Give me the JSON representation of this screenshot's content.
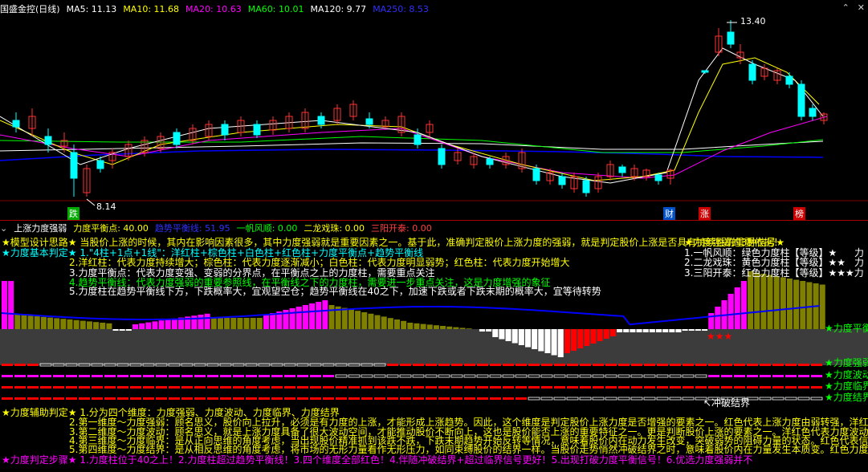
{
  "header": {
    "stock": "国盛金控(日线)",
    "ma": [
      {
        "label": "MA5: 11.13",
        "color": "#ffffff"
      },
      {
        "label": "MA10: 11.68",
        "color": "#ffff00"
      },
      {
        "label": "MA20: 10.63",
        "color": "#ff00ff"
      },
      {
        "label": "MA60: 10.01",
        "color": "#00ff00"
      },
      {
        "label": "MA120: 9.77",
        "color": "#ffffff"
      },
      {
        "label": "MA250: 8.53",
        "color": "#0000ff"
      }
    ]
  },
  "window": {
    "collapse_icon": "chevron-up-icon",
    "close_icon": "close-icon"
  },
  "price_annotations": {
    "high": "13.40",
    "low": "8.14"
  },
  "bottom_markers": [
    {
      "label": "跌",
      "color": "#00aa00"
    },
    {
      "label": "财",
      "color": "#0050c8"
    },
    {
      "label": "涨",
      "color": "#cc0000"
    },
    {
      "label": "榜",
      "color": "#cc0000"
    }
  ],
  "subchart": {
    "title": "上涨力度强弱",
    "params": [
      {
        "label": "力度平衡点: 40.00",
        "color": "#ffff00"
      },
      {
        "label": "趋势平衡线: 51.95",
        "color": "#0000ff"
      },
      {
        "label": "一帆风顺: 0.00",
        "color": "#00ff00"
      },
      {
        "label": "二龙戏珠: 0.00",
        "color": "#ffff00"
      },
      {
        "label": "三阳开泰: 0.00",
        "color": "#ff4040"
      }
    ]
  },
  "notes": {
    "design": "★模型设计思路★ 当股价上涨的时候，其内在影响因素很多，其中力度强弱就是重要因素之一。基于此，准确判定股价上涨力度的强弱，就是判定股价上涨是否具有持续性的重要依据！",
    "basic_title": "★力度基本判定★ 1.\"4柱+1点+1线\"：洋红柱+棕色柱+白色柱+红色柱+力度平衡点+趋势平衡线",
    "basic_2": "2.洋红柱：代表力度持续增大；棕色柱：代表力度逐渐减小；白色柱：代表力度明显弱势；红色柱：代表力度开始增大",
    "basic_3": "3.力度平衡点：代表力度变强、变弱的分界点，在平衡点之上的力度柱，需要重点关注",
    "basic_4": "4.趋势平衡线：代表力度强弱的重要参照线，在平衡线之下的力度柱，需要进一步重点关注，这是力度增强的象征",
    "basic_5": "5.力度柱在趋势平衡线下方，下跌概率大，宜观望空仓；趋势平衡线在40之下，加速下跌或者下跌末期的概率大，宜等待转势",
    "signals_title": "★力度强弱的3种信号★",
    "signal_1": "1.一帆风顺：绿色力度柱【等级】★",
    "signal_2": "2.二龙戏珠：黄色力度柱【等级】★★",
    "signal_3": "3.三阳开泰：红色力度柱【等级】★★★力",
    "signal_1_tail": "力",
    "signal_2_tail": "力",
    "stars": "★★★",
    "side_labels": [
      "★力度平衡",
      "★力度强弱",
      "★力度波动",
      "★力度临界",
      "★力度结界"
    ],
    "breakout": "↖冲破结界",
    "aux_title": "★力度辅助判定★ 1.分为四个维度：力度强弱、力度波动、力度临界、力度结界",
    "aux_2": "2.第一维度～力度强弱：顾名思义，股价向上拉升，必须是有力度的上涨，才能形成上涨趋势。因此，这个维度是判定股价上涨力度是否增强的要素之一。红色代表上涨力度由弱转强，洋红",
    "aux_3": "3.第二维度～力度波动：顾名思义，就是上涨力度具备了很大波动空间，才能推动股价不断向上，这也是股价能否上涨的重要特征之一。更是判断股价上涨的要素之一。洋红色代表力度波动",
    "aux_4": "4.第三维度～力度临界：是从正向思维的角度考虑，当出现股价精准抓到该跌不跌，下跌末期趋势开始反转等情况，意味着股价内在动力发生改变，突破弱势的阻碍力量的状态。红色代表信号",
    "aux_5": "5.第四维度～力度结界：是从相反思维的角度考虑，将市场的无形力量看作无形压力，如同束缚股价的结界一样。当股价走势悄然冲破结界之时，意味着股价内在力量发生本质变。红色力度结",
    "steps": "★力度判定步骤★ 1.力度柱位于40之上！2.力度柱超过趋势平衡线！3.四个维度全部红色！4.伴随冲破结界+超过临界信号更好！5.出现打破力度平衡信号！6.优选力度强弱并不"
  },
  "colors": {
    "up": "#ff3232",
    "down": "#00ffff",
    "magenta": "#ff00ff",
    "olive": "#808000",
    "white": "#ffffff",
    "red": "#ff0000",
    "blue": "#0000ff",
    "green": "#00ff00",
    "yellow": "#ffff00",
    "gray_bg": "#3c3c3c"
  }
}
